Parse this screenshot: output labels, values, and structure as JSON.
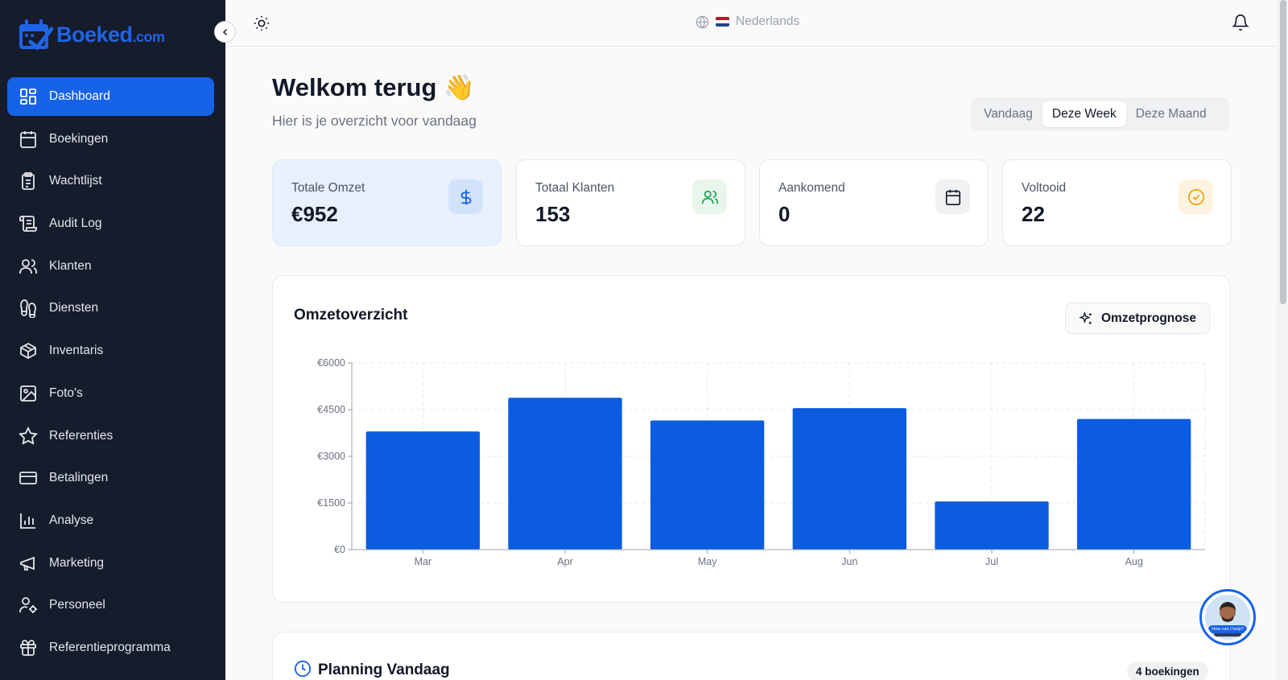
{
  "brand": {
    "name": "Boeked",
    "suffix": ".com",
    "color": "#1f63e6"
  },
  "sidebar": {
    "items": [
      {
        "label": "Dashboard",
        "icon": "dashboard-grid-icon",
        "active": true
      },
      {
        "label": "Boekingen",
        "icon": "calendar-icon"
      },
      {
        "label": "Wachtlijst",
        "icon": "clipboard-list-icon"
      },
      {
        "label": "Audit Log",
        "icon": "scroll-icon"
      },
      {
        "label": "Klanten",
        "icon": "users-icon"
      },
      {
        "label": "Diensten",
        "icon": "footprints-icon"
      },
      {
        "label": "Inventaris",
        "icon": "package-icon"
      },
      {
        "label": "Foto's",
        "icon": "image-icon"
      },
      {
        "label": "Referenties",
        "icon": "star-icon"
      },
      {
        "label": "Betalingen",
        "icon": "credit-card-icon"
      },
      {
        "label": "Analyse",
        "icon": "bar-chart-icon"
      },
      {
        "label": "Marketing",
        "icon": "megaphone-icon"
      },
      {
        "label": "Personeel",
        "icon": "user-cog-icon"
      },
      {
        "label": "Referentieprogramma",
        "icon": "gift-icon"
      }
    ]
  },
  "topbar": {
    "language": "Nederlands"
  },
  "header": {
    "title": "Welkom terug 👋",
    "subtitle": "Hier is je overzicht voor vandaag"
  },
  "period": {
    "options": [
      "Vandaag",
      "Deze Week",
      "Deze Maand"
    ],
    "selected": "Deze Week"
  },
  "stats": [
    {
      "label": "Totale Omzet",
      "value": "€952",
      "icon": "dollar-icon",
      "color": "#1763e8"
    },
    {
      "label": "Totaal Klanten",
      "value": "153",
      "icon": "users-icon",
      "color": "#16a34a"
    },
    {
      "label": "Aankomend",
      "value": "0",
      "icon": "calendar-icon",
      "color": "#111827"
    },
    {
      "label": "Voltooid",
      "value": "22",
      "icon": "check-circle-icon",
      "color": "#f59e0b"
    }
  ],
  "revenue": {
    "title": "Omzetoverzicht",
    "forecast_button": "Omzetprognose"
  },
  "chart_data": {
    "type": "bar",
    "categories": [
      "Mar",
      "Apr",
      "May",
      "Jun",
      "Jul",
      "Aug"
    ],
    "values": [
      3800,
      4880,
      4150,
      4550,
      1550,
      4200
    ],
    "ylim": [
      0,
      6000
    ],
    "yticks": [
      0,
      1500,
      3000,
      4500,
      6000
    ],
    "ytick_labels": [
      "€0",
      "€1500",
      "€3000",
      "€4500",
      "€6000"
    ],
    "grid": true,
    "bar_color": "#0b5ce0"
  },
  "planning": {
    "title": "Planning Vandaag",
    "badge": "4 boekingen"
  },
  "help": {
    "label": "How can I help?"
  }
}
